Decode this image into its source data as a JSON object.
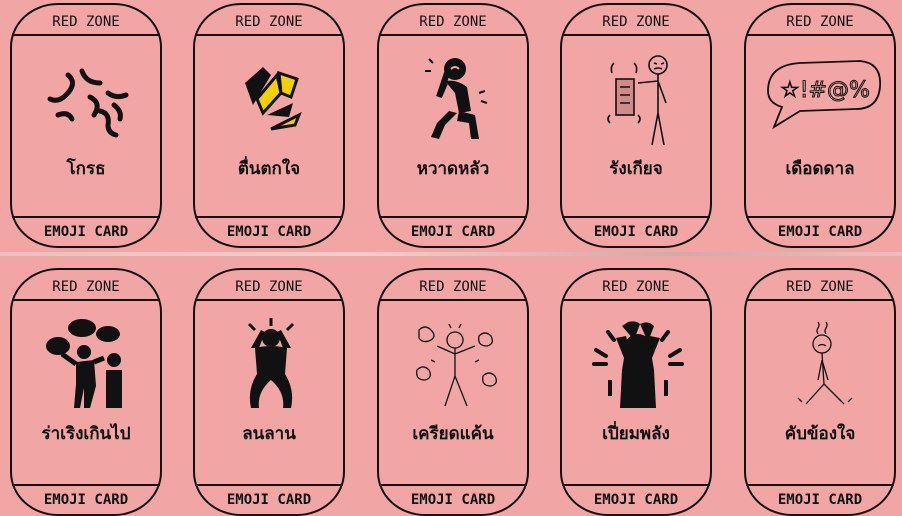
{
  "cards": [
    {
      "top": "RED ZONE",
      "emotion": "โกรธ",
      "bottom": "EMOJI CARD",
      "icon": "angry-symbol-icon"
    },
    {
      "top": "RED ZONE",
      "emotion": "ตื่นตกใจ",
      "bottom": "EMOJI CARD",
      "icon": "shattered-shapes-icon"
    },
    {
      "top": "RED ZONE",
      "emotion": "หวาดหลัว",
      "bottom": "EMOJI CARD",
      "icon": "scared-person-icon"
    },
    {
      "top": "RED ZONE",
      "emotion": "รังเกียจ",
      "bottom": "EMOJI CARD",
      "icon": "disgusted-person-icon"
    },
    {
      "top": "RED ZONE",
      "emotion": "เดือดดาล",
      "bottom": "EMOJI CARD",
      "icon": "curse-speech-bubble-icon"
    },
    {
      "top": "RED ZONE",
      "emotion": "ร่าเริงเกินไป",
      "bottom": "EMOJI CARD",
      "icon": "chatty-people-icon"
    },
    {
      "top": "RED ZONE",
      "emotion": "ลนลาน",
      "bottom": "EMOJI CARD",
      "icon": "panicked-person-icon"
    },
    {
      "top": "RED ZONE",
      "emotion": "เครียดแค้น",
      "bottom": "EMOJI CARD",
      "icon": "fuming-person-icon"
    },
    {
      "top": "RED ZONE",
      "emotion": "เปี่ยมพลัง",
      "bottom": "EMOJI CARD",
      "icon": "energetic-person-icon"
    },
    {
      "top": "RED ZONE",
      "emotion": "คับข้องใจ",
      "bottom": "EMOJI CARD",
      "icon": "frustrated-person-icon"
    }
  ]
}
